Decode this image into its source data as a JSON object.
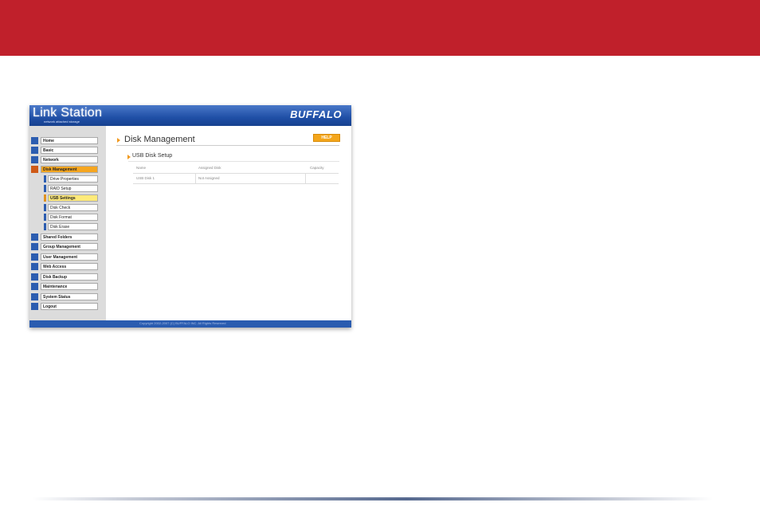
{
  "app": {
    "brand": "Link Station",
    "brand_subtitle": "network attached storage",
    "vendor": "BUFFALO",
    "footer": "Copyright 2002-2007 (C) BUFFALO INC. All Rights Reserved"
  },
  "colors": {
    "slide_band": "#c0202b",
    "banner": "#1f4fa6",
    "active_item": "#f6a620",
    "help_button": "#f4a61c"
  },
  "sidebar": {
    "items": [
      {
        "label": "Home",
        "icon": "home-icon"
      },
      {
        "label": "Basic",
        "icon": "basic-settings-icon"
      },
      {
        "label": "Network",
        "icon": "network-icon"
      },
      {
        "label": "Disk Management",
        "icon": "disk-icon",
        "active": true
      },
      {
        "label": "Shared Folders",
        "icon": "folder-icon"
      },
      {
        "label": "Group Management",
        "icon": "group-icon"
      },
      {
        "label": "User Management",
        "icon": "user-icon"
      },
      {
        "label": "Web Access",
        "icon": "globe-icon"
      },
      {
        "label": "Disk Backup",
        "icon": "backup-icon"
      },
      {
        "label": "Maintenance",
        "icon": "maintenance-icon"
      },
      {
        "label": "System Status",
        "icon": "status-icon"
      },
      {
        "label": "Logout",
        "icon": "logout-icon"
      }
    ],
    "subitems": [
      {
        "label": "Drive Properties"
      },
      {
        "label": "RAID Setup"
      },
      {
        "label": "USB Settings",
        "active": true
      },
      {
        "label": "Disk Check"
      },
      {
        "label": "Disk Format"
      },
      {
        "label": "Disk Erase"
      }
    ]
  },
  "main": {
    "title": "Disk Management",
    "help_label": "HELP",
    "section_title": "USB Disk Setup",
    "table": {
      "headers": [
        "Name",
        "Assigned Disk",
        "Capacity"
      ],
      "rows": [
        [
          "USB Disk 1",
          "Not Assigned",
          ""
        ]
      ]
    }
  }
}
